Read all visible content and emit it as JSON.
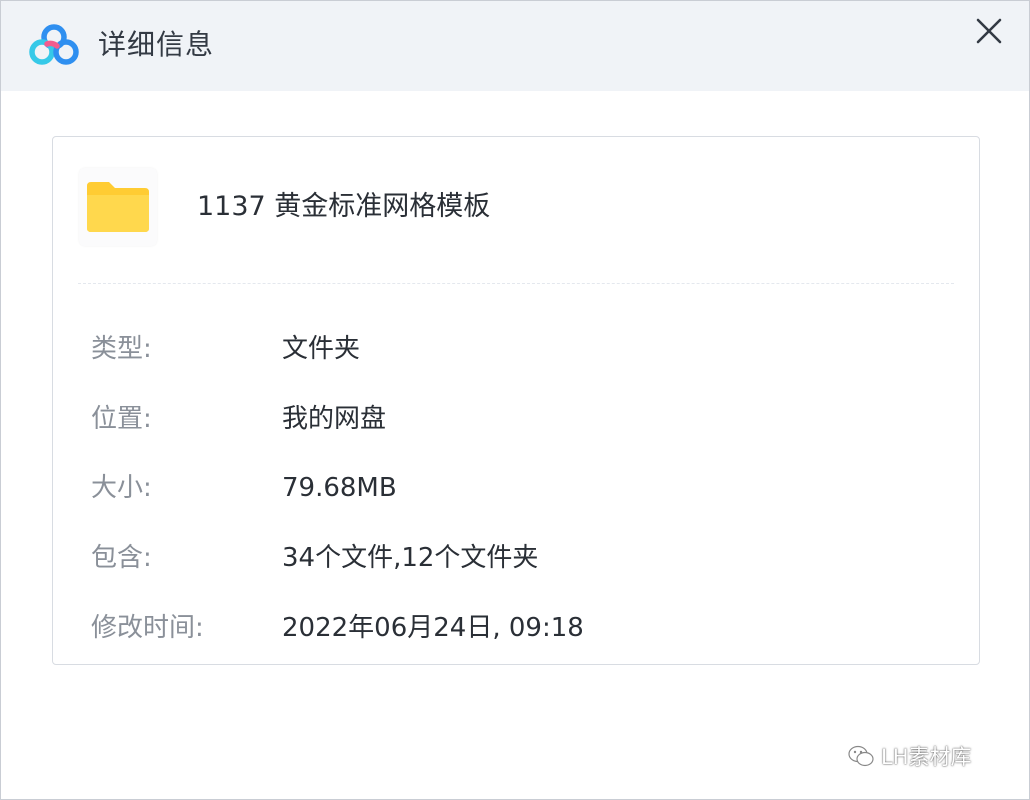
{
  "window": {
    "title": "详细信息",
    "close_icon": "close-icon",
    "app_icon": "baidu-netdisk-logo-icon"
  },
  "file": {
    "name": "1137 黄金标准网格模板",
    "icon": "folder-icon",
    "folder_color": "#ffcc33"
  },
  "details": [
    {
      "label": "类型:",
      "value": "文件夹"
    },
    {
      "label": "位置:",
      "value": "我的网盘"
    },
    {
      "label": "大小:",
      "value": "79.68MB"
    },
    {
      "label": "包含:",
      "value": "34个文件,12个文件夹"
    },
    {
      "label": "修改时间:",
      "value": "2022年06月24日, 09:18"
    }
  ],
  "watermark": {
    "text": "LH素材库",
    "icon": "wechat-icon"
  },
  "colors": {
    "titlebar_bg": "#f0f3f7",
    "label_text": "#8a9099",
    "value_text": "#2a2f36",
    "logo_blue": "#2f8ff0",
    "logo_cyan": "#36c9e8",
    "logo_pink": "#f25c8e"
  }
}
